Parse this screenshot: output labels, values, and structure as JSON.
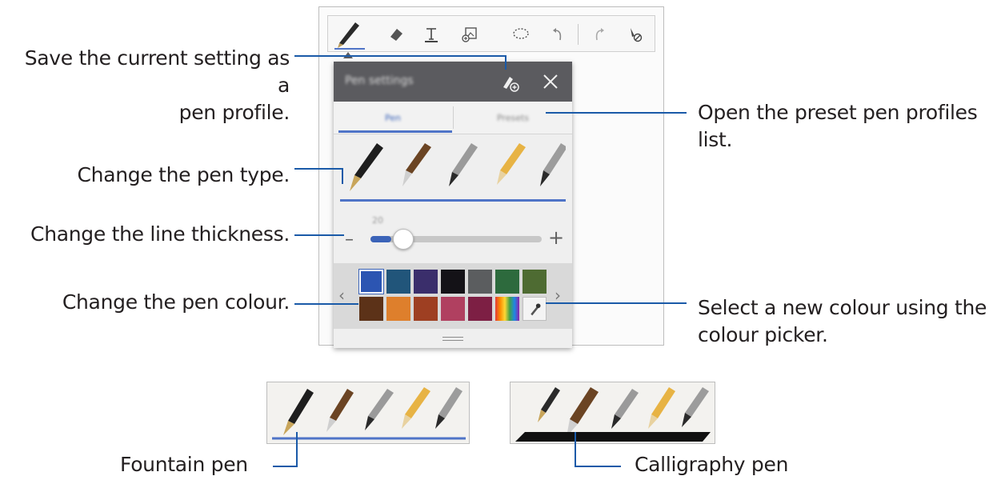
{
  "callouts": {
    "save_profile": "Save the current setting as a pen profile.",
    "save_profile_line1": "Save the current setting as a",
    "save_profile_line2": "pen profile.",
    "preset_line1": "Open the preset pen profiles",
    "preset_line2": "list.",
    "pen_type": "Change the pen type.",
    "line_thickness": "Change the line thickness.",
    "pen_colour": "Change the pen colour.",
    "picker_line1": "Select a new colour using the",
    "picker_line2": "colour picker.",
    "fountain": "Fountain pen",
    "calligraphy": "Calligraphy pen"
  },
  "toolbar": {
    "tools": [
      "pen-icon",
      "eraser-icon",
      "text-icon",
      "image-insert-icon",
      "lasso-icon",
      "undo-icon",
      "redo-icon",
      "pen-only-icon"
    ]
  },
  "panel": {
    "title": "Pen settings",
    "tabs": [
      "Pen",
      "Presets"
    ],
    "size_label": "20",
    "slider_value": 0.12,
    "icons": [
      "add-profile-icon",
      "close-icon",
      "eyedropper-icon"
    ]
  },
  "palette": {
    "row1": [
      "#2c55b2",
      "#21557a",
      "#3a2e6b",
      "#141217",
      "#5b5d5f",
      "#2d6a3d",
      "#4e6b32"
    ],
    "row2": [
      "#5c3218",
      "#de7f2c",
      "#9e3f22",
      "#b04060",
      "#7d1f44",
      "spectrum",
      "eyedropper"
    ]
  },
  "colors": {
    "leader_line": "#1a5aa8",
    "panel_header": "#5b5b5f",
    "accent": "#4f74c7"
  }
}
